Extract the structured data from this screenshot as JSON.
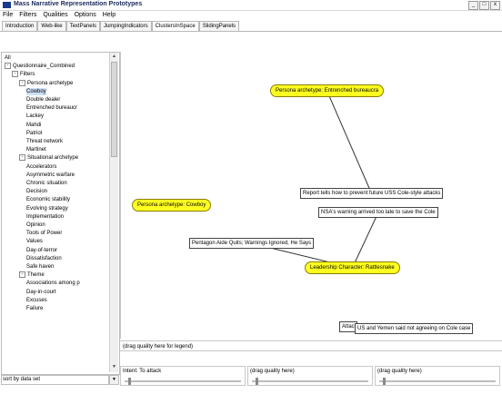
{
  "window": {
    "title": "Mass Narrative Representation Prototypes",
    "controls": [
      "_",
      "□",
      "x"
    ]
  },
  "menu": [
    "File",
    "Filters",
    "Qualities",
    "Options",
    "Help"
  ],
  "tabs": [
    {
      "label": "Introduction",
      "active": false
    },
    {
      "label": "Web-like",
      "active": false
    },
    {
      "label": "TextPanels",
      "active": false
    },
    {
      "label": "JumpingIndicators",
      "active": false
    },
    {
      "label": "ClustersInSpace",
      "active": true
    },
    {
      "label": "SlidingPanels",
      "active": false
    }
  ],
  "tree": {
    "items": [
      {
        "label": "All",
        "level": 0,
        "expander": ""
      },
      {
        "label": "Questionnaire_Combined",
        "level": 0,
        "expander": "-"
      },
      {
        "label": "Filters",
        "level": 1,
        "expander": "-"
      },
      {
        "label": "Persona archetype",
        "level": 2,
        "expander": "-"
      },
      {
        "label": "Cowboy",
        "level": 3,
        "expander": "",
        "selected": true
      },
      {
        "label": "Double dealer",
        "level": 3,
        "expander": ""
      },
      {
        "label": "Entrenched bureaucr",
        "level": 3,
        "expander": ""
      },
      {
        "label": "Lackey",
        "level": 3,
        "expander": ""
      },
      {
        "label": "Mahdi",
        "level": 3,
        "expander": ""
      },
      {
        "label": "Patriot",
        "level": 3,
        "expander": ""
      },
      {
        "label": "Threat network",
        "level": 3,
        "expander": ""
      },
      {
        "label": "Martinet",
        "level": 3,
        "expander": ""
      },
      {
        "label": "Situational archetype",
        "level": 2,
        "expander": "-"
      },
      {
        "label": "Accelerators",
        "level": 3,
        "expander": ""
      },
      {
        "label": "Asymmetric warfare",
        "level": 3,
        "expander": ""
      },
      {
        "label": "Chronic situation",
        "level": 3,
        "expander": ""
      },
      {
        "label": "Decision",
        "level": 3,
        "expander": ""
      },
      {
        "label": "Economic stability",
        "level": 3,
        "expander": ""
      },
      {
        "label": "Evolving strategy",
        "level": 3,
        "expander": ""
      },
      {
        "label": "Implementation",
        "level": 3,
        "expander": ""
      },
      {
        "label": "Opinion",
        "level": 3,
        "expander": ""
      },
      {
        "label": "Tools of Power",
        "level": 3,
        "expander": ""
      },
      {
        "label": "Values",
        "level": 3,
        "expander": ""
      },
      {
        "label": "Day-of-terror",
        "level": 3,
        "expander": ""
      },
      {
        "label": "Dissatisfaction",
        "level": 3,
        "expander": ""
      },
      {
        "label": "Safe haven",
        "level": 3,
        "expander": ""
      },
      {
        "label": "Theme",
        "level": 2,
        "expander": "-"
      },
      {
        "label": "Associations among p",
        "level": 3,
        "expander": ""
      },
      {
        "label": "Day-in-court",
        "level": 3,
        "expander": ""
      },
      {
        "label": "Excuses",
        "level": 3,
        "expander": ""
      },
      {
        "label": "Failure",
        "level": 3,
        "expander": ""
      }
    ],
    "footer": "sort by data set"
  },
  "graph": {
    "nodes": [
      {
        "id": "n1",
        "label": "Persona archetype: Entrenched bureaucra",
        "style": "yellow"
      },
      {
        "id": "n2",
        "label": "Persona archetype: Cowboy",
        "style": "yellow"
      },
      {
        "id": "n3",
        "label": "Leadership Character: Rattlesnake",
        "style": "yellow"
      },
      {
        "id": "n4",
        "label": "Report tells how to prevent future USS Cole-style attacks",
        "style": "box"
      },
      {
        "id": "n5",
        "label": "NSA's warning arrived too late to save the Cole",
        "style": "box"
      },
      {
        "id": "n6",
        "label": "Pentagon Aide Quits; Warnings Ignored, He Says",
        "style": "box"
      },
      {
        "id": "n7",
        "label": "Attac",
        "style": "box"
      },
      {
        "id": "n8",
        "label": "US and Yemen said not agreeing on Cole case",
        "style": "box"
      }
    ],
    "edges": [
      [
        "n1",
        "n4"
      ],
      [
        "n3",
        "n5"
      ],
      [
        "n3",
        "n6"
      ]
    ]
  },
  "legend": {
    "placeholder": "(drag quality here for legend)"
  },
  "bottom_slots": [
    {
      "label": "Intent: To attack"
    },
    {
      "label": "(drag quality here)"
    },
    {
      "label": "(drag quality here)"
    }
  ]
}
